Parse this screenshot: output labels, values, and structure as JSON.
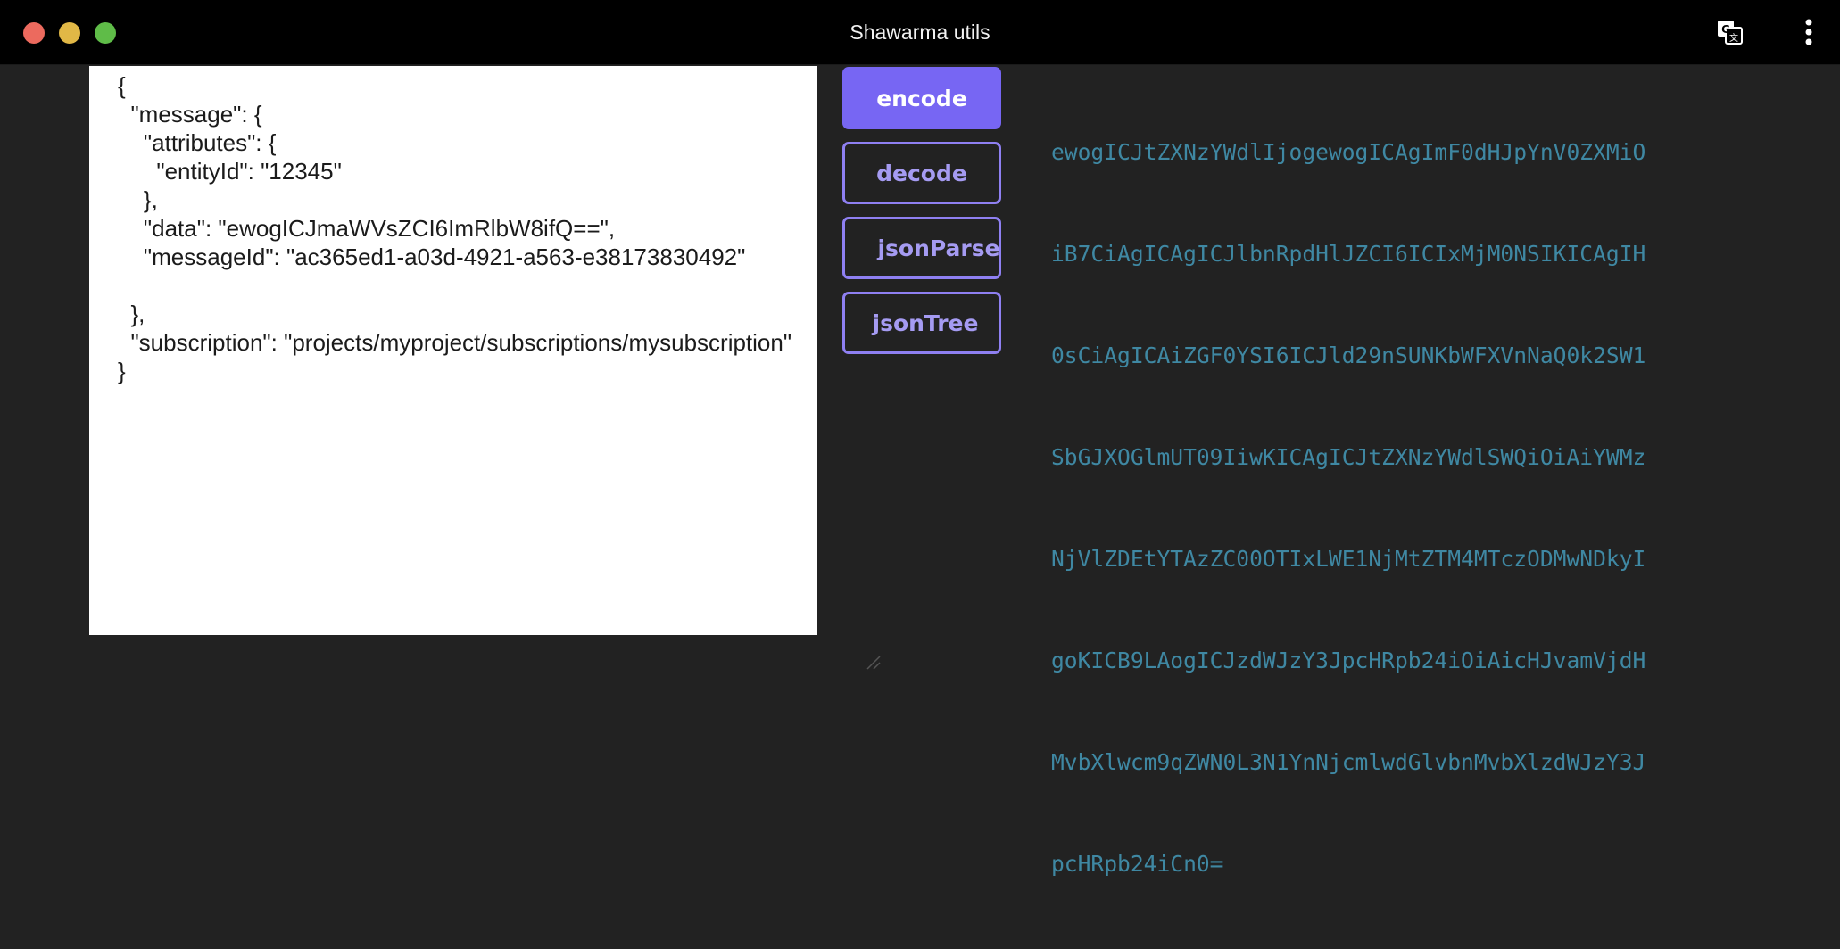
{
  "window": {
    "title": "Shawarma utils"
  },
  "icons": {
    "translate": "translate-icon",
    "more": "more-vertical-icon"
  },
  "editor": {
    "value": "{\n  \"message\": {\n    \"attributes\": {\n      \"entityId\": \"12345\"\n    },\n    \"data\": \"ewogICJmaWVsZCI6ImRlbW8ifQ==\",\n    \"messageId\": \"ac365ed1-a03d-4921-a563-e38173830492\"\n\n  },\n  \"subscription\": \"projects/myproject/subscriptions/mysubscription\"\n}"
  },
  "buttons": {
    "encode": "encode",
    "decode": "decode",
    "jsonParse": "jsonParse",
    "jsonTree": "jsonTree"
  },
  "output": {
    "lines": [
      "ewogICJtZXNzYWdlIjogewogICAgImF0dHJpYnV0ZXMiO",
      "iB7CiAgICAgICJlbnRpdHlJZCI6ICIxMjM0NSIKICAgIH",
      "0sCiAgICAiZGF0YSI6ICJld29nSUNKbWFXVnNaQ0k2SW1",
      "SbGJXOGlmUT09IiwKICAgICJtZXNzYWdlSWQiOiAiYWMz",
      "NjVlZDEtYTAzZC00OTIxLWE1NjMtZTM4MTczODMwNDkyI",
      "goKICB9LAogICJzdWJzY3JpcHRpb24iOiAicHJvamVjdH",
      "MvbXlwcm9qZWN0L3N1YnNjcmlwdGlvbnMvbXlzdWJzY3J",
      "pcHRpb24iCn0="
    ]
  },
  "colors": {
    "accent": "#7766f3",
    "output_text": "#3f88a3",
    "background": "#222222",
    "titlebar": "#000000"
  }
}
